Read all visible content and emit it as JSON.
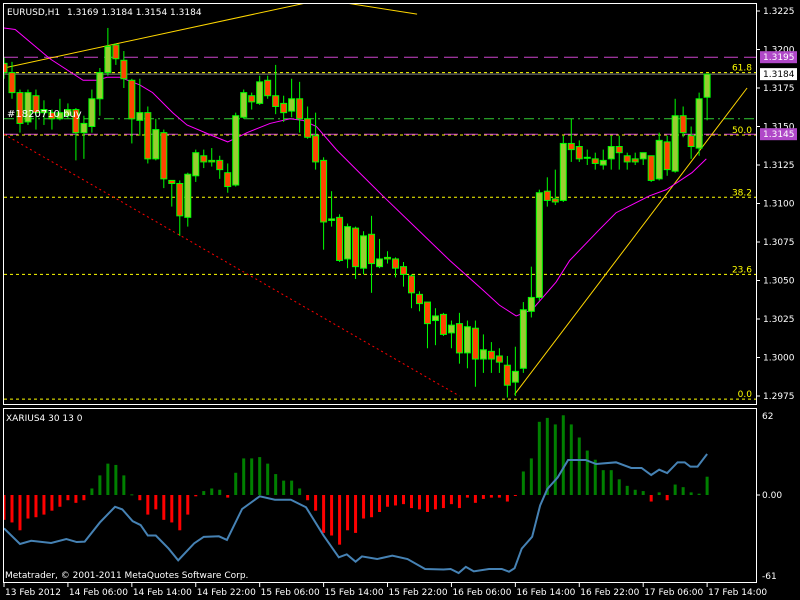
{
  "header": {
    "symbol": "EURUSD,H1",
    "ohlc": "1.3169 1.3184 1.3154 1.3184"
  },
  "order_label": "#1820710 buy",
  "indicator": {
    "title": "XARIUS4 30 13 0",
    "copyright": "Metatrader, © 2001-2011 MetaQuotes Software Corp.",
    "axis_labels": [
      "62",
      "0.00",
      "-61"
    ]
  },
  "colors": {
    "bull_body": "#9acd32",
    "bear_body": "#ff4500",
    "wick": "#00ff00",
    "ma": "#ff00ff",
    "fib": "#ffff00",
    "hist_up": "#008000",
    "hist_down": "#ff0000",
    "signal": "#4682b4",
    "trend": "#ffd700",
    "support": "#ff0000"
  },
  "chart_data": [
    {
      "type": "candlestick",
      "title": "EURUSD,H1",
      "ylim": [
        1.297,
        1.3235
      ],
      "price_ticks": [
        "1.3225",
        "1.3200",
        "1.3175",
        "1.3150",
        "1.3125",
        "1.3100",
        "1.3075",
        "1.3050",
        "1.3025",
        "1.3000",
        "1.2975"
      ],
      "time_ticks": [
        "13 Feb 2012",
        "14 Feb 06:00",
        "14 Feb 14:00",
        "14 Feb 22:00",
        "15 Feb 06:00",
        "15 Feb 14:00",
        "15 Feb 22:00",
        "16 Feb 06:00",
        "16 Feb 14:00",
        "16 Feb 22:00",
        "17 Feb 06:00",
        "17 Feb 14:00"
      ],
      "time_tick_bar_step": 8,
      "candles_ohlc": [
        [
          1.3191,
          1.3195,
          1.3181,
          1.3185
        ],
        [
          1.3185,
          1.3192,
          1.3168,
          1.3172
        ],
        [
          1.3172,
          1.3174,
          1.3146,
          1.3152
        ],
        [
          1.3153,
          1.3174,
          1.3151,
          1.3172
        ],
        [
          1.317,
          1.3174,
          1.3148,
          1.3159
        ],
        [
          1.3159,
          1.3167,
          1.3151,
          1.3161
        ],
        [
          1.3159,
          1.3161,
          1.3148,
          1.3155
        ],
        [
          1.3155,
          1.3168,
          1.3154,
          1.3159
        ],
        [
          1.3157,
          1.3165,
          1.3155,
          1.3161
        ],
        [
          1.3161,
          1.3162,
          1.3128,
          1.3146
        ],
        [
          1.3146,
          1.3157,
          1.3129,
          1.3152
        ],
        [
          1.315,
          1.3174,
          1.3146,
          1.3168
        ],
        [
          1.3168,
          1.3188,
          1.3157,
          1.3185
        ],
        [
          1.3185,
          1.3214,
          1.3183,
          1.3202
        ],
        [
          1.3203,
          1.3204,
          1.319,
          1.3194
        ],
        [
          1.3193,
          1.3199,
          1.3175,
          1.3181
        ],
        [
          1.318,
          1.3181,
          1.3139,
          1.3155
        ],
        [
          1.3154,
          1.3181,
          1.3144,
          1.3159
        ],
        [
          1.3159,
          1.3163,
          1.3126,
          1.3129
        ],
        [
          1.3129,
          1.3155,
          1.3128,
          1.3148
        ],
        [
          1.3146,
          1.3148,
          1.311,
          1.3116
        ],
        [
          1.3115,
          1.3115,
          1.3098,
          1.3113
        ],
        [
          1.3113,
          1.3115,
          1.3079,
          1.3092
        ],
        [
          1.3091,
          1.312,
          1.3085,
          1.3119
        ],
        [
          1.3118,
          1.3135,
          1.3114,
          1.3133
        ],
        [
          1.3131,
          1.3135,
          1.3123,
          1.3127
        ],
        [
          1.3128,
          1.3136,
          1.3124,
          1.3127
        ],
        [
          1.3128,
          1.3131,
          1.3116,
          1.3122
        ],
        [
          1.312,
          1.3126,
          1.3107,
          1.3111
        ],
        [
          1.3112,
          1.3159,
          1.3111,
          1.3157
        ],
        [
          1.3156,
          1.3174,
          1.3155,
          1.3172
        ],
        [
          1.317,
          1.3172,
          1.3161,
          1.3166
        ],
        [
          1.3165,
          1.3183,
          1.3164,
          1.3179
        ],
        [
          1.318,
          1.3183,
          1.3168,
          1.317
        ],
        [
          1.317,
          1.319,
          1.3158,
          1.3163
        ],
        [
          1.3165,
          1.317,
          1.3153,
          1.3159
        ],
        [
          1.316,
          1.3181,
          1.3156,
          1.3168
        ],
        [
          1.3168,
          1.3179,
          1.3146,
          1.3155
        ],
        [
          1.3155,
          1.3163,
          1.3142,
          1.3143
        ],
        [
          1.3144,
          1.3159,
          1.3122,
          1.3127
        ],
        [
          1.3128,
          1.313,
          1.307,
          1.3088
        ],
        [
          1.3089,
          1.3108,
          1.3085,
          1.309
        ],
        [
          1.3091,
          1.3093,
          1.3062,
          1.3063
        ],
        [
          1.3064,
          1.3087,
          1.3058,
          1.3085
        ],
        [
          1.3084,
          1.3085,
          1.3051,
          1.3059
        ],
        [
          1.3058,
          1.3082,
          1.3054,
          1.3079
        ],
        [
          1.308,
          1.3092,
          1.3042,
          1.3061
        ],
        [
          1.3059,
          1.3077,
          1.3058,
          1.3064
        ],
        [
          1.3065,
          1.3069,
          1.3061,
          1.3064
        ],
        [
          1.3064,
          1.3065,
          1.3052,
          1.3058
        ],
        [
          1.3059,
          1.3062,
          1.3046,
          1.3054
        ],
        [
          1.3053,
          1.3054,
          1.3032,
          1.3042
        ],
        [
          1.3041,
          1.3043,
          1.303,
          1.3035
        ],
        [
          1.3036,
          1.3036,
          1.3006,
          1.3022
        ],
        [
          1.3024,
          1.3032,
          1.3008,
          1.3027
        ],
        [
          1.3028,
          1.3029,
          1.3014,
          1.3015
        ],
        [
          1.3016,
          1.3024,
          1.3006,
          1.3021
        ],
        [
          1.3022,
          1.3029,
          1.2996,
          1.3003
        ],
        [
          1.3003,
          1.3024,
          1.2993,
          1.302
        ],
        [
          1.3019,
          1.3024,
          1.2981,
          1.2999
        ],
        [
          1.2999,
          1.3015,
          1.299,
          1.3005
        ],
        [
          1.3004,
          1.301,
          1.299,
          1.2999
        ],
        [
          1.3001,
          1.3006,
          1.299,
          1.2997
        ],
        [
          1.2995,
          1.3001,
          1.2974,
          1.2982
        ],
        [
          1.2984,
          1.3007,
          1.2975,
          1.2991
        ],
        [
          1.2993,
          1.3036,
          1.299,
          1.3031
        ],
        [
          1.303,
          1.3059,
          1.3026,
          1.3039
        ],
        [
          1.3039,
          1.3109,
          1.3037,
          1.3107
        ],
        [
          1.3108,
          1.3117,
          1.3098,
          1.3102
        ],
        [
          1.3103,
          1.3122,
          1.3099,
          1.3101
        ],
        [
          1.3102,
          1.3144,
          1.3101,
          1.3139
        ],
        [
          1.3139,
          1.3155,
          1.3127,
          1.3135
        ],
        [
          1.3137,
          1.3141,
          1.3127,
          1.3129
        ],
        [
          1.313,
          1.3135,
          1.3125,
          1.313
        ],
        [
          1.3129,
          1.3133,
          1.3122,
          1.3126
        ],
        [
          1.3125,
          1.3135,
          1.3122,
          1.3128
        ],
        [
          1.3129,
          1.3144,
          1.3122,
          1.3137
        ],
        [
          1.3137,
          1.3144,
          1.3122,
          1.3133
        ],
        [
          1.3131,
          1.3133,
          1.3122,
          1.3127
        ],
        [
          1.3129,
          1.3133,
          1.3125,
          1.3127
        ],
        [
          1.3129,
          1.3133,
          1.3125,
          1.3133
        ],
        [
          1.3131,
          1.3131,
          1.3114,
          1.3115
        ],
        [
          1.3116,
          1.3146,
          1.3115,
          1.3141
        ],
        [
          1.314,
          1.3144,
          1.3118,
          1.3122
        ],
        [
          1.3121,
          1.3168,
          1.312,
          1.3157
        ],
        [
          1.3157,
          1.3163,
          1.3143,
          1.3146
        ],
        [
          1.3144,
          1.315,
          1.3129,
          1.3137
        ],
        [
          1.3136,
          1.3172,
          1.3131,
          1.3168
        ],
        [
          1.3169,
          1.3184,
          1.3154,
          1.3184
        ]
      ],
      "moving_average_bar_price": [
        [
          0,
          1.3214
        ],
        [
          1.4,
          1.3213
        ],
        [
          5.75,
          1.3194
        ],
        [
          9.9,
          1.318
        ],
        [
          11.6,
          1.318
        ],
        [
          12.9,
          1.3182
        ],
        [
          14.5,
          1.3182
        ],
        [
          17,
          1.3177
        ],
        [
          18.6,
          1.3172
        ],
        [
          21.1,
          1.3159
        ],
        [
          22.9,
          1.3151
        ],
        [
          26.1,
          1.3144
        ],
        [
          28,
          1.314
        ],
        [
          30.4,
          1.3146
        ],
        [
          33.3,
          1.3152
        ],
        [
          35.8,
          1.3155
        ],
        [
          37.4,
          1.3154
        ],
        [
          39.1,
          1.315
        ],
        [
          41.6,
          1.3135
        ],
        [
          44.1,
          1.3122
        ],
        [
          47.4,
          1.3105
        ],
        [
          51.6,
          1.3084
        ],
        [
          55.8,
          1.3063
        ],
        [
          59.9,
          1.3044
        ],
        [
          62,
          1.3034
        ],
        [
          64.1,
          1.3027
        ],
        [
          66.1,
          1.3031
        ],
        [
          69.1,
          1.3049
        ],
        [
          70.8,
          1.3063
        ],
        [
          74.5,
          1.3083
        ],
        [
          76.6,
          1.3094
        ],
        [
          80.8,
          1.3105
        ],
        [
          82.9,
          1.3109
        ],
        [
          86.1,
          1.312
        ],
        [
          87.9,
          1.3129
        ]
      ],
      "horizontal_lines": [
        {
          "name": "resistance",
          "price": 1.3195,
          "label": "1.3195",
          "color": "#cc44cc"
        },
        {
          "name": "support",
          "price": 1.3145,
          "label": "1.3145",
          "color": "#cc44cc"
        },
        {
          "name": "current-price",
          "price": 1.3184,
          "label": "1.3184",
          "color": "#808080"
        },
        {
          "name": "buy-order",
          "price": 1.3155,
          "color": "#32cd32"
        }
      ],
      "fibonacci": {
        "low": 1.2973,
        "high": 1.3316,
        "levels": [
          {
            "ratio": 0.618,
            "label": "61.8"
          },
          {
            "ratio": 0.5,
            "label": "50.0"
          },
          {
            "ratio": 0.382,
            "label": "38.2"
          },
          {
            "ratio": 0.236,
            "label": "23.6"
          },
          {
            "ratio": 0,
            "label": "0.0"
          }
        ]
      },
      "trendlines_bar_price": [
        {
          "name": "upper-trendline",
          "color": "#ffd700",
          "from": [
            0,
            1.3188
          ],
          "to": [
            38.5,
            1.3231
          ]
        },
        {
          "name": "upper-trendline-2",
          "color": "#ffd700",
          "from": [
            41.8,
            1.3231
          ],
          "to": [
            51.7,
            1.3223
          ]
        },
        {
          "name": "rising-trendline",
          "color": "#ffd700",
          "from": [
            63.9,
            1.2976
          ],
          "to": [
            93,
            1.3175
          ]
        },
        {
          "name": "falling-support-line",
          "color": "#ff0000",
          "from": [
            0,
            1.3145
          ],
          "to": [
            57,
            1.2975
          ]
        }
      ]
    },
    {
      "type": "bar",
      "title": "XARIUS4 30 13 0",
      "ylim": [
        -61,
        62
      ],
      "histogram": [
        -19,
        -21,
        -27,
        -18,
        -17,
        -15,
        -12,
        -9,
        -4,
        -6,
        -4,
        5,
        15,
        24,
        23,
        15,
        0.5,
        -4,
        -15,
        -11,
        -19,
        -21,
        -27,
        -15,
        -1,
        3,
        5,
        4,
        -2,
        17,
        28,
        28,
        29,
        24,
        16,
        11,
        11,
        5,
        -4,
        -12,
        -29,
        -31,
        -38,
        -27,
        -29,
        -18,
        -17,
        -13,
        -9,
        -8,
        -7,
        -10,
        -11,
        -13,
        -11,
        -10,
        -7,
        -10,
        -2,
        -6,
        -3,
        -2,
        -2,
        -5,
        -0.5,
        18,
        28,
        56,
        59,
        54,
        61,
        54,
        44,
        34,
        27,
        19,
        19,
        12,
        7,
        4,
        3,
        -5,
        2,
        -4,
        8,
        6,
        2,
        1,
        14
      ],
      "signal_line_bar_value": [
        [
          0,
          -25.5
        ],
        [
          2,
          -37.5
        ],
        [
          3.4,
          -35
        ],
        [
          5.9,
          -36.7
        ],
        [
          7.8,
          -33.7
        ],
        [
          9.1,
          -36
        ],
        [
          10.1,
          -35.7
        ],
        [
          12,
          -21
        ],
        [
          13.9,
          -9
        ],
        [
          14.8,
          -11
        ],
        [
          16.1,
          -20
        ],
        [
          17.1,
          -23
        ],
        [
          18,
          -31
        ],
        [
          19,
          -31
        ],
        [
          20.6,
          -41
        ],
        [
          21.8,
          -50
        ],
        [
          23.8,
          -37
        ],
        [
          25,
          -32
        ],
        [
          26.9,
          -31.6
        ],
        [
          27.9,
          -34.4
        ],
        [
          29.8,
          -10.7
        ],
        [
          32,
          -1
        ],
        [
          33.9,
          -3.6
        ],
        [
          35.9,
          -3.6
        ],
        [
          37.8,
          -9.4
        ],
        [
          40,
          -31
        ],
        [
          41.9,
          -47.7
        ],
        [
          42.9,
          -45.4
        ],
        [
          44,
          -51
        ],
        [
          44.8,
          -47
        ],
        [
          46.7,
          -49
        ],
        [
          48.6,
          -46.4
        ],
        [
          50.5,
          -49
        ],
        [
          52.7,
          -56.6
        ],
        [
          55,
          -57
        ],
        [
          55.9,
          -56.6
        ],
        [
          56.9,
          -59.7
        ],
        [
          57.8,
          -55
        ],
        [
          58.8,
          -58.4
        ],
        [
          60.7,
          -56.6
        ],
        [
          62.3,
          -56.6
        ],
        [
          63.2,
          -58.7
        ],
        [
          63.9,
          -56
        ],
        [
          64.8,
          -41
        ],
        [
          66.1,
          -32
        ],
        [
          67.1,
          -8
        ],
        [
          68,
          4.6
        ],
        [
          69.3,
          13.5
        ],
        [
          70.6,
          26.8
        ],
        [
          72.8,
          26.8
        ],
        [
          74.1,
          23.7
        ],
        [
          76.6,
          25
        ],
        [
          78.5,
          20.7
        ],
        [
          79.8,
          20.7
        ],
        [
          81,
          15.3
        ],
        [
          82,
          19.4
        ],
        [
          83,
          16.8
        ],
        [
          84.3,
          25
        ],
        [
          85.2,
          25
        ],
        [
          85.9,
          21.7
        ],
        [
          86.8,
          21.7
        ],
        [
          88,
          31.4
        ]
      ]
    }
  ]
}
